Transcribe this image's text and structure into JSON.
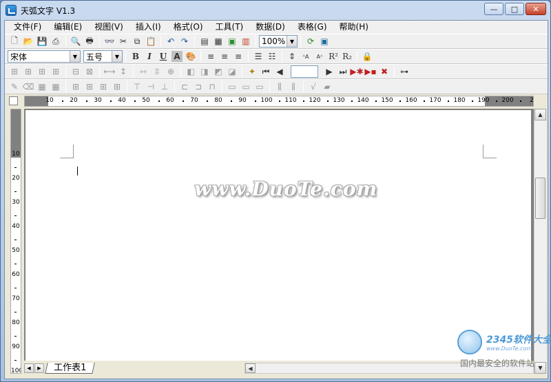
{
  "window": {
    "title": "天弧文字 V1.3",
    "minimize": "—",
    "maximize": "□",
    "close": "✕"
  },
  "menu": [
    "文件(F)",
    "编辑(E)",
    "视图(V)",
    "插入(I)",
    "格式(O)",
    "工具(T)",
    "数据(D)",
    "表格(G)",
    "帮助(H)"
  ],
  "toolbar1": {
    "zoom": "100%"
  },
  "toolbar2": {
    "font": "宋体",
    "size": "五号",
    "bold": "B",
    "italic": "I",
    "underline": "U",
    "shade": "A"
  },
  "ruler_h": [
    "10",
    "20",
    "30",
    "40",
    "50",
    "60",
    "70",
    "80",
    "90",
    "100",
    "110",
    "120",
    "130",
    "140",
    "150",
    "160",
    "170",
    "180",
    "190",
    "200",
    "2"
  ],
  "ruler_v": [
    "10",
    "20",
    "30",
    "40",
    "50",
    "60",
    "70",
    "80",
    "90",
    "100"
  ],
  "watermark": "www.DuoTe.com",
  "sheet_tab": "工作表1",
  "logo": {
    "brand": "2345软件大全",
    "url": "www.DuoTe.com",
    "tagline": "国内最安全的软件站"
  }
}
